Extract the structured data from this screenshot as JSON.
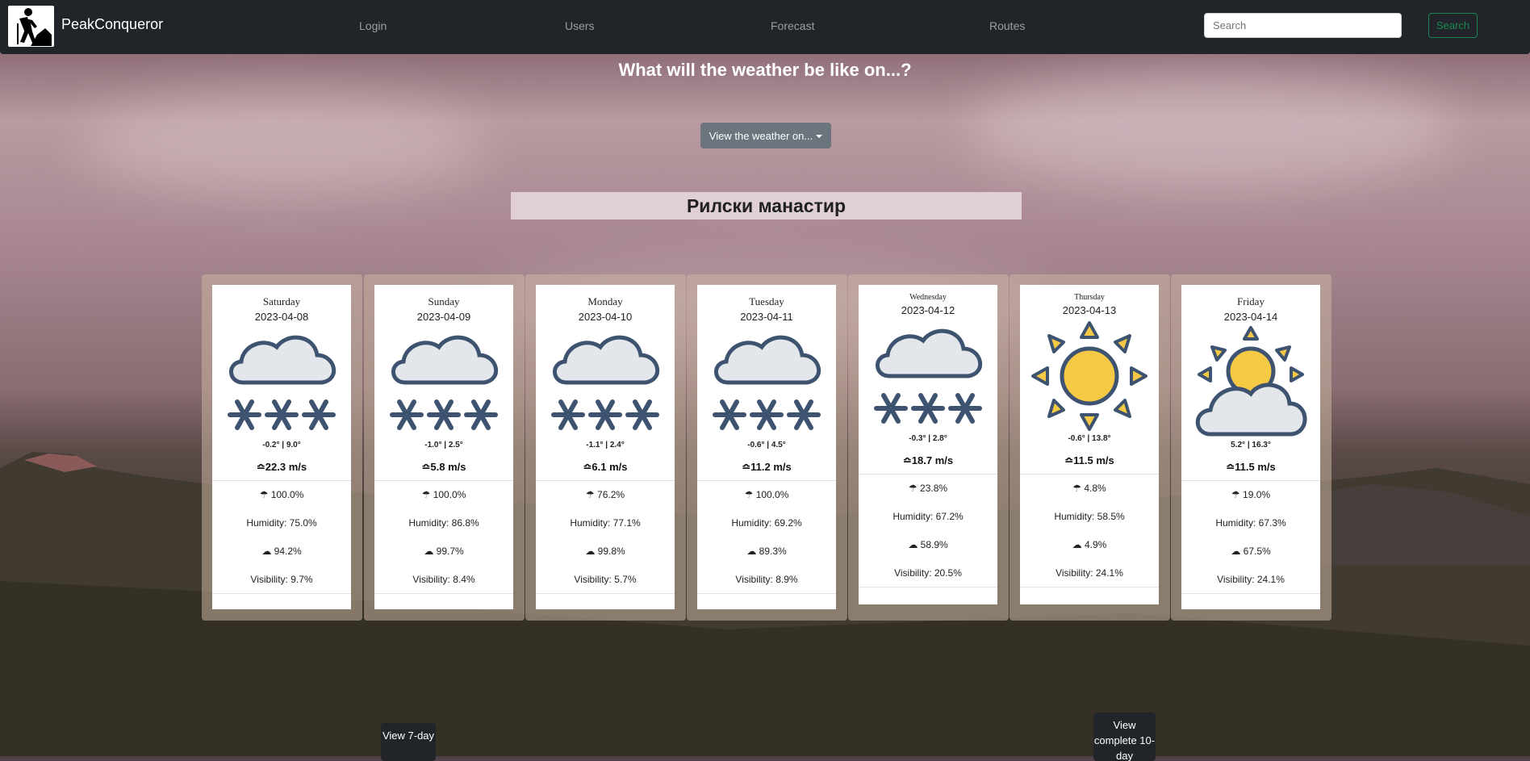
{
  "brand": "PeakConqueror",
  "nav": [
    "Login",
    "Users",
    "Forecast",
    "Routes"
  ],
  "search": {
    "placeholder": "Search",
    "button": "Search"
  },
  "question": "What will the weather be like on...?",
  "dropdown_label": "View the weather on...",
  "place": "Рилски манастир",
  "days": [
    {
      "day": "Saturday",
      "date": "2023-04-08",
      "icon": "snow-cloud-icon",
      "temps": "-0.2° | 9.0°",
      "wind": "22.3 m/s",
      "rain": "100.0%",
      "humidity": "Humidity: 75.0%",
      "cloud": "94.2%",
      "visibility": "Visibility: 9.7%"
    },
    {
      "day": "Sunday",
      "date": "2023-04-09",
      "icon": "snow-cloud-icon",
      "temps": "-1.0° | 2.5°",
      "wind": "5.8 m/s",
      "rain": "100.0%",
      "humidity": "Humidity: 86.8%",
      "cloud": "99.7%",
      "visibility": "Visibility: 8.4%"
    },
    {
      "day": "Monday",
      "date": "2023-04-10",
      "icon": "snow-cloud-icon",
      "temps": "-1.1° | 2.4°",
      "wind": "6.1 m/s",
      "rain": "76.2%",
      "humidity": "Humidity: 77.1%",
      "cloud": "99.8%",
      "visibility": "Visibility: 5.7%"
    },
    {
      "day": "Tuesday",
      "date": "2023-04-11",
      "icon": "snow-cloud-icon",
      "temps": "-0.6° | 4.5°",
      "wind": "11.2 m/s",
      "rain": "100.0%",
      "humidity": "Humidity: 69.2%",
      "cloud": "89.3%",
      "visibility": "Visibility: 8.9%"
    },
    {
      "day": "Wednesday",
      "date": "2023-04-12",
      "icon": "snow-cloud-icon",
      "temps": "-0.3° | 2.8°",
      "wind": "18.7 m/s",
      "rain": "23.8%",
      "humidity": "Humidity: 67.2%",
      "cloud": "58.9%",
      "visibility": "Visibility: 20.5%"
    },
    {
      "day": "Thursday",
      "date": "2023-04-13",
      "icon": "sun-icon",
      "temps": "-0.6° | 13.8°",
      "wind": "11.5 m/s",
      "rain": "4.8%",
      "humidity": "Humidity: 58.5%",
      "cloud": "4.9%",
      "visibility": "Visibility: 24.1%"
    },
    {
      "day": "Friday",
      "date": "2023-04-14",
      "icon": "sun-cloud-icon",
      "temps": "5.2° | 16.3°",
      "wind": "11.5 m/s",
      "rain": "19.0%",
      "humidity": "Humidity: 67.3%",
      "cloud": "67.5%",
      "visibility": "Visibility: 24.1%"
    }
  ],
  "tooltip_7day": "View 7-day",
  "tooltip_complete": "View complete 10-day",
  "colors": {
    "navbar": "#212529",
    "success": "#198754",
    "secondary": "#6c757d"
  }
}
